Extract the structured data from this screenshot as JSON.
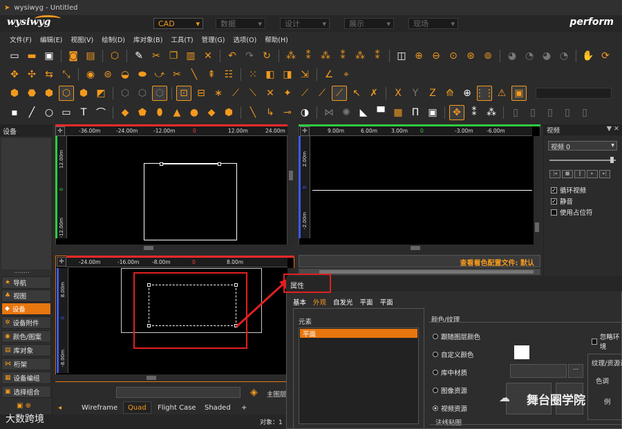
{
  "window": {
    "title": "wysiwyg - Untitled"
  },
  "brand": {
    "name": "wysiwyg",
    "right_logo": "perform"
  },
  "modes": [
    {
      "label": "CAD",
      "active": true
    },
    {
      "label": "数据",
      "active": false
    },
    {
      "label": "设计",
      "active": false
    },
    {
      "label": "展示",
      "active": false
    },
    {
      "label": "现场",
      "active": false
    }
  ],
  "menu": [
    "文件(F)",
    "编辑(E)",
    "视图(V)",
    "绘制(D)",
    "库对象(B)",
    "工具(T)",
    "管理(G)",
    "选项(O)",
    "帮助(H)"
  ],
  "toolbar_icons": {
    "row1": [
      "new-file",
      "open-folder",
      "save",
      "print-preview",
      "print",
      "3d-box",
      "pen",
      "cut",
      "copy",
      "paste",
      "delete",
      "undo",
      "redo",
      "refresh",
      "select-all",
      "select-class",
      "select-layer",
      "select-prev",
      "select-loop",
      "select-inverse",
      "render",
      "zoom-in",
      "zoom-out",
      "zoom-fit",
      "zoom-window",
      "zoom-extents",
      "camera-a",
      "camera-b",
      "camera-c",
      "camera-d",
      "hand",
      "orbit"
    ],
    "row2": [
      "move",
      "rotate",
      "mirror",
      "scale",
      "align",
      "offset",
      "pipe",
      "flip-select",
      "fillet",
      "trim",
      "line-tool",
      "stretch",
      "array",
      "explode",
      "group",
      "ungroup",
      "measure",
      "dimension",
      "angle",
      "coord"
    ],
    "row3": [
      "view-top",
      "view-front",
      "view-side",
      "view-iso",
      "view-back",
      "view-bottom",
      "wire-box",
      "solid-box",
      "snap-grid",
      "snap-end",
      "snap-mid",
      "snap-int",
      "snap-perp",
      "snap-center",
      "snap-node",
      "snap-quad",
      "snap-near",
      "snap-tan",
      "axis-x",
      "axis-y",
      "axis-z",
      "ortho",
      "lock",
      "grid-dots",
      "warning",
      "frame"
    ],
    "row4": [
      "point",
      "line",
      "circle",
      "rectangle",
      "text",
      "arc",
      "plane",
      "block",
      "cylinder",
      "cone",
      "sphere",
      "cube",
      "prism",
      "bar",
      "hook",
      "clamp",
      "target",
      "truss",
      "light",
      "projector",
      "screen",
      "video-wall",
      "curtain",
      "camera",
      "effect",
      "dmx",
      "console",
      "rig"
    ]
  },
  "left_panel": {
    "title": "设备",
    "dots": "........",
    "items": [
      {
        "label": "导航",
        "icon": "star-icon",
        "active": false
      },
      {
        "label": "视图",
        "icon": "sitemap-icon",
        "active": false
      },
      {
        "label": "设备",
        "icon": "lamp-icon",
        "active": true
      },
      {
        "label": "设备附件",
        "icon": "gear-icon",
        "active": false
      },
      {
        "label": "颜色/图案",
        "icon": "palette-icon",
        "active": false
      },
      {
        "label": "库对象",
        "icon": "book-icon",
        "active": false
      },
      {
        "label": "桁架",
        "icon": "truss-icon",
        "active": false
      },
      {
        "label": "设备编组",
        "icon": "group-icon",
        "active": false
      },
      {
        "label": "选择组合",
        "icon": "select-icon",
        "active": false
      }
    ]
  },
  "viewports": {
    "top_left": {
      "ruler_x": [
        "-36.00m",
        "-24.00m",
        "-12.00m",
        "0",
        "12.00m",
        "24.00m"
      ],
      "ruler_y": [
        "12.00m",
        "0",
        "-12.00m"
      ]
    },
    "top_right": {
      "ruler_x": [
        "9.00m",
        "6.00m",
        "3.00m",
        "0",
        "-3.00m",
        "-6.00m"
      ],
      "ruler_y": [
        "2.00m",
        "0",
        "-2.00m"
      ]
    },
    "bottom_left": {
      "ruler_x": [
        "-24.00m",
        "-16.00m",
        "-8.00m",
        "0",
        "8.00m"
      ],
      "ruler_y": [
        "8.00m",
        "0",
        "-8.00m"
      ]
    },
    "bottom_right_status": "查看着色配置文件: 默认"
  },
  "right_panel": {
    "title": "视频",
    "pin": "▼ ✕",
    "select_value": "视频 0",
    "checks": [
      {
        "label": "循环视频",
        "checked": true
      },
      {
        "label": "静音",
        "checked": true
      },
      {
        "label": "使用占位符",
        "checked": false
      }
    ]
  },
  "properties": {
    "title": "属性",
    "tabs": [
      "基本",
      "外观",
      "自发光",
      "平面",
      "平面"
    ],
    "active_tab": 1,
    "element_label": "元素",
    "element_item": "平面",
    "color_section": "颜色/纹理",
    "radios": [
      {
        "label": "跟随图层颜色",
        "on": false
      },
      {
        "label": "自定义颜色",
        "on": false
      },
      {
        "label": "库中材质",
        "on": false
      },
      {
        "label": "图像资源",
        "on": false
      },
      {
        "label": "视频资源",
        "on": true
      }
    ],
    "ignore_env": "忽略环境",
    "texture_label": "纹理/资源设",
    "hue_label": "色调",
    "ratio_label": "例",
    "normal_map": "法线贴图",
    "browse": "..."
  },
  "bottom": {
    "tabs": [
      {
        "label": "Wireframe",
        "active": false
      },
      {
        "label": "Quad",
        "active": true
      },
      {
        "label": "Flight Case",
        "active": false
      },
      {
        "label": "Shaded",
        "active": false
      },
      {
        "label": "+",
        "active": false
      }
    ],
    "layer_label": "主图层",
    "object_count": "对象：1"
  },
  "watermarks": {
    "bottom_left": "大数跨境",
    "bottom_right": "舞台圈学院"
  },
  "colors": {
    "accent": "#f39a1e",
    "active_bg": "#e8760f",
    "highlight_red": "#e02020",
    "ruler_red": "#ff2a2a",
    "ruler_green": "#2ecc40",
    "ruler_blue": "#3a5bff"
  }
}
